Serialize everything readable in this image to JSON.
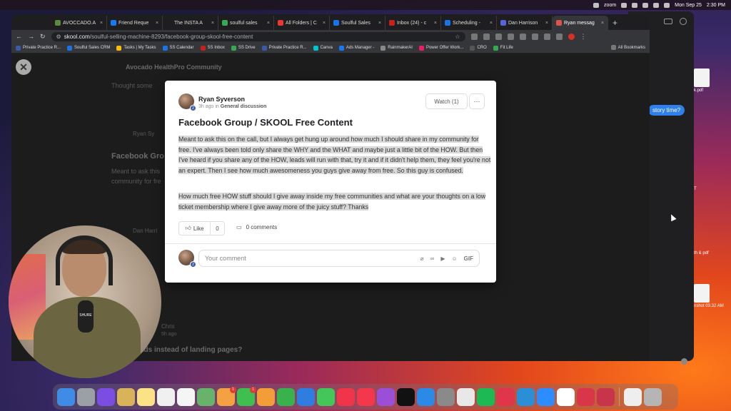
{
  "menubar": {
    "right_items": [
      "zoom"
    ],
    "date": "Mon Sep 25",
    "time": "2:30 PM"
  },
  "browser": {
    "tabs": [
      {
        "label": "AVOCCADO.A",
        "color": "#5c8a3a"
      },
      {
        "label": "Friend Reque",
        "color": "#1877f2"
      },
      {
        "label": "The INSTA A",
        "color": "#1e1e20"
      },
      {
        "label": "soulful sales",
        "color": "#34a853"
      },
      {
        "label": "All Folders | C",
        "color": "#e53935"
      },
      {
        "label": "Soulful Sales",
        "color": "#1a73e8"
      },
      {
        "label": "Inbox (24) - c",
        "color": "#c5221f"
      },
      {
        "label": "Scheduling -",
        "color": "#1a73e8"
      },
      {
        "label": "Dan Harrison",
        "color": "#5b61d6"
      },
      {
        "label": "Ryan messag",
        "color": "#d9534f"
      }
    ],
    "url_host": "skool.com",
    "url_path": "/soulful-selling-machine-8293/facebook-group-skool-free-content",
    "bookmarks": [
      {
        "label": "Private Practice R...",
        "color": "#3b5ba8"
      },
      {
        "label": "Soulful Sales CRM",
        "color": "#1a73e8"
      },
      {
        "label": "Tasks | My Tasks",
        "color": "#fbbc04"
      },
      {
        "label": "SS Calendar",
        "color": "#1a73e8"
      },
      {
        "label": "SS Inbox",
        "color": "#c5221f"
      },
      {
        "label": "SS Drive",
        "color": "#34a853"
      },
      {
        "label": "Private Practice R...",
        "color": "#3b5ba8"
      },
      {
        "label": "Canva",
        "color": "#00c4cc"
      },
      {
        "label": "Ads Manager -",
        "color": "#1877f2"
      },
      {
        "label": "RainmakerAI",
        "color": "#888"
      },
      {
        "label": "Power Offer Work...",
        "color": "#e91e63"
      },
      {
        "label": "CRO",
        "color": "#555"
      },
      {
        "label": "Fit Life",
        "color": "#34a853"
      }
    ],
    "all_bookmarks": "All Bookmarks"
  },
  "background_page": {
    "community_title": "Avocado HealthPro Community",
    "post_snippet": "Thought some",
    "author2": "Ryan Sy",
    "title2": "Facebook Gro",
    "body2a": "Meant to ask this",
    "body2b": "community for fre",
    "author3": "Dan Harri",
    "title3": "ads instead of landing pages?",
    "author4": "Chris",
    "time4": "5h ago"
  },
  "modal": {
    "author": "Ryan Syverson",
    "level": "2",
    "time": "3h ago",
    "in_text": "in",
    "category": "General discussion",
    "watch_label": "Watch (1)",
    "more_label": "···",
    "title": "Facebook Group / SKOOL Free Content",
    "paragraph1": "Meant to ask this on the call, but I always get hung up around how much I should share in my community for free. I've always been told only share the WHY and the WHAT and maybe just a little bit of the HOW. But then I've heard if you share any of the HOW, leads will run with that, try it and if it didn't help them, they feel you're not an expert. Then I see how much awesomeness you guys give away from free. So this guy is confused.",
    "paragraph2": "How much free HOW stuff should I give away inside my free communities and what are your thoughts on a low ticket membership where I give away more of the juicy stuff? Thanks",
    "like_label": "Like",
    "like_count": "0",
    "comments_label": "0 comments",
    "comment_placeholder": "Your comment",
    "gif_label": "GIF"
  },
  "webcam": {
    "mic_brand": "SHURE"
  },
  "messages": {
    "bubble": "story time?"
  },
  "files": [
    {
      "label": "k.pdf"
    },
    {
      "label": "T"
    },
    {
      "label": "th & pdf"
    },
    {
      "label": "nshot 03.32 AM"
    }
  ],
  "dock": {
    "apps": [
      {
        "name": "finder",
        "color": "#3f8ce6"
      },
      {
        "name": "launchpad",
        "color": "#9aa0a6"
      },
      {
        "name": "siri",
        "color": "#7b4de0"
      },
      {
        "name": "notes-dock",
        "color": "#d9b35a"
      },
      {
        "name": "notes",
        "color": "#fbe286"
      },
      {
        "name": "freeform",
        "color": "#f0f0f0"
      },
      {
        "name": "reminders",
        "color": "#f5f5f5"
      },
      {
        "name": "maps",
        "color": "#68b36b"
      },
      {
        "name": "photos",
        "color": "#f4a142",
        "badge": "1"
      },
      {
        "name": "facetime",
        "color": "#3fbf4f",
        "badge": "1"
      },
      {
        "name": "pages",
        "color": "#f29d38"
      },
      {
        "name": "numbers",
        "color": "#37b24d"
      },
      {
        "name": "keynote",
        "color": "#2e7de1"
      },
      {
        "name": "messages",
        "color": "#44c65a"
      },
      {
        "name": "news",
        "color": "#f0354a"
      },
      {
        "name": "music",
        "color": "#f2384a"
      },
      {
        "name": "podcasts",
        "color": "#9b4fd6"
      },
      {
        "name": "apple-tv",
        "color": "#111111"
      },
      {
        "name": "app-store",
        "color": "#2a8ae6"
      },
      {
        "name": "system-settings",
        "color": "#8a8a8a"
      },
      {
        "name": "chrome",
        "color": "#e8e8e8"
      },
      {
        "name": "spotify",
        "color": "#1db954"
      },
      {
        "name": "airtable",
        "color": "#e0354b"
      },
      {
        "name": "edge",
        "color": "#2a8fd6"
      },
      {
        "name": "zoom",
        "color": "#2d8cff"
      },
      {
        "name": "slack",
        "color": "#ffffff"
      },
      {
        "name": "live-app",
        "color": "#d9364a"
      },
      {
        "name": "cast-app",
        "color": "#c8344a"
      }
    ],
    "right": [
      {
        "name": "documents",
        "color": "#eeeeee"
      },
      {
        "name": "trash",
        "color": "#b5b5b5"
      }
    ]
  }
}
